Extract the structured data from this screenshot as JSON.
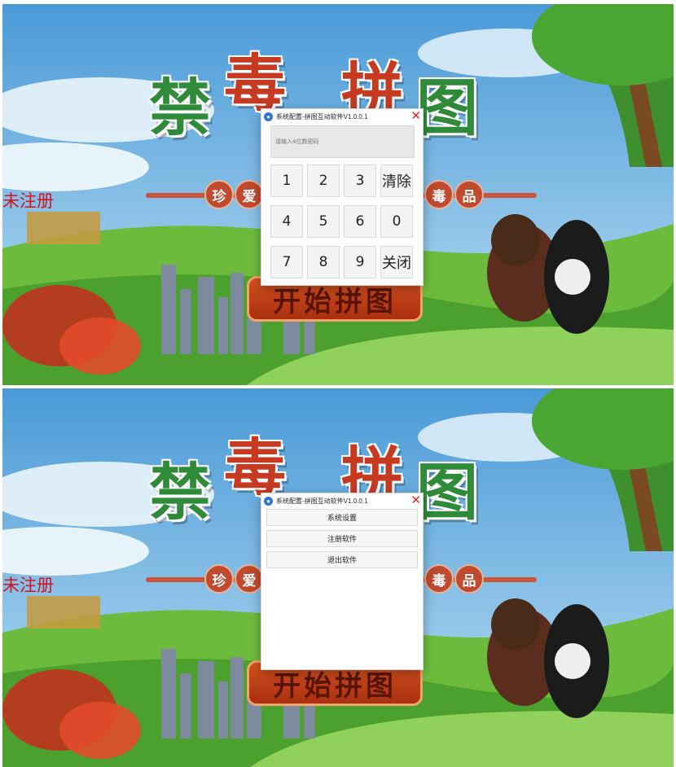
{
  "poster": {
    "title_chars": [
      "禁",
      "毒",
      "拼",
      "图"
    ],
    "slogan_left": [
      "珍",
      "爱"
    ],
    "slogan_right": [
      "毒",
      "品"
    ],
    "start_button": "开始拼图",
    "registration_status": "未注册"
  },
  "pin_dialog": {
    "title": "系统配置-拼图互动软件V1.0.0.1",
    "close_symbol": "✕",
    "pin_placeholder": "请输入4位数密码",
    "keys": [
      "1",
      "2",
      "3",
      "清除",
      "4",
      "5",
      "6",
      "0",
      "7",
      "8",
      "9",
      "关闭"
    ]
  },
  "menu_dialog": {
    "title": "系统配置-拼图互动软件V1.0.0.1",
    "close_symbol": "✕",
    "buttons": [
      "系统设置",
      "注册软件",
      "退出软件"
    ]
  },
  "colors": {
    "accent_red": "#e0262b",
    "status_red": "#d2141c",
    "title_green": "#2f8b3a"
  }
}
